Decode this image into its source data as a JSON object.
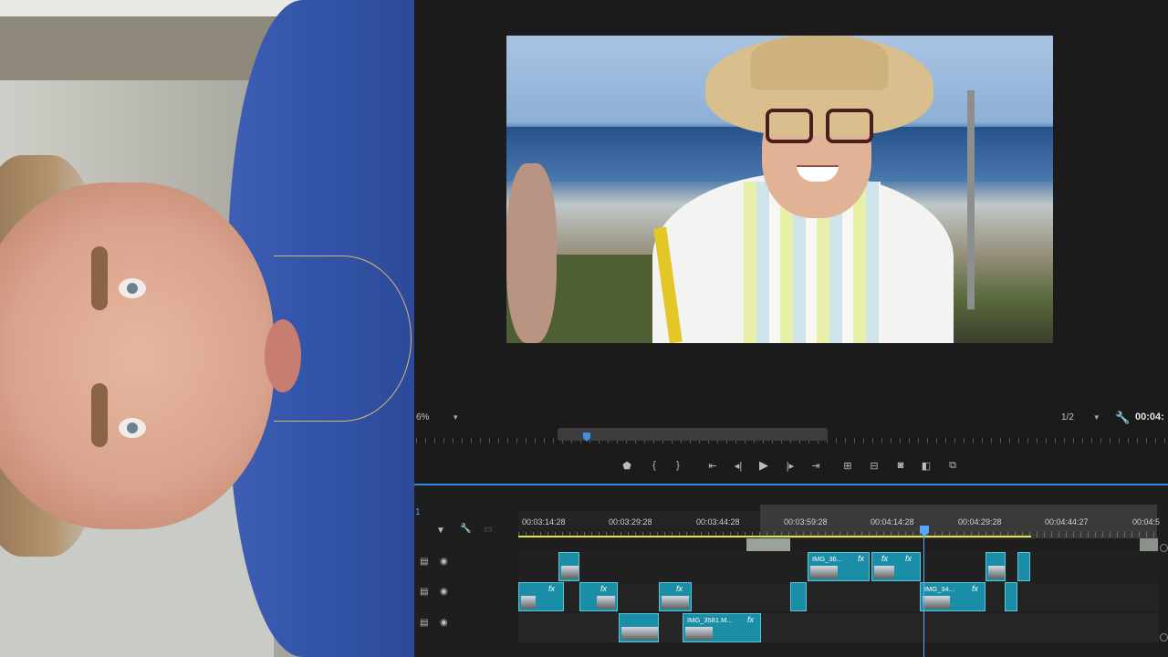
{
  "monitor": {
    "zoom_value": "6%",
    "resolution_value": "1/2",
    "timecode": "00:04:",
    "transport_icons": [
      "marker-icon",
      "mark-in-icon",
      "mark-out-icon",
      "go-to-in-icon",
      "step-back-icon",
      "play-icon",
      "step-forward-icon",
      "go-to-out-icon",
      "lift-icon",
      "extract-icon",
      "export-frame-icon",
      "compare-icon",
      "multicam-icon"
    ]
  },
  "timeline": {
    "sequence_label": "1",
    "timecodes": [
      "00:03:14:28",
      "00:03:29:28",
      "00:03:44:28",
      "00:03:59:28",
      "00:04:14:28",
      "00:04:29:28",
      "00:04:44:27",
      "00:04:5"
    ],
    "clips": [
      {
        "name": "IMG_36..."
      },
      {
        "name": "IMG_34..."
      },
      {
        "name": "IMG_3581.M..."
      }
    ],
    "fx_label": "fx"
  },
  "colors": {
    "accent": "#2d8ceb",
    "clip": "#1a8ea6",
    "workarea": "#e3e24a"
  }
}
